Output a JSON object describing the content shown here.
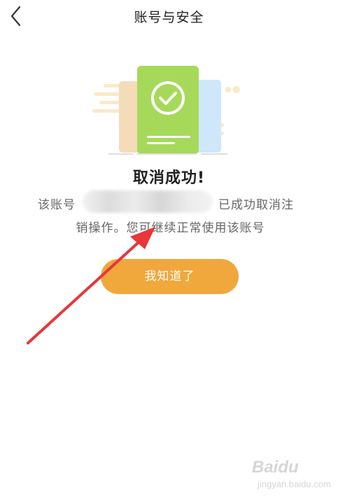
{
  "nav": {
    "title": "账号与安全",
    "back_icon": "chevron-left-icon"
  },
  "result": {
    "title": "取消成功!",
    "desc_prefix": "该账号",
    "desc_suffix": "已成功取消注",
    "desc_line2": "销操作。您可继续正常使用该账号"
  },
  "button": {
    "label": "我知道了"
  },
  "watermark": {
    "brand": "Baidu",
    "sub": "jingyan.baidu.com"
  },
  "colors": {
    "accent_button": "#f0a73c",
    "card_green": "#a6d95a",
    "card_beige": "#f4dcb8",
    "card_blue": "#cfe7fb",
    "annotation_arrow": "#e8363a"
  }
}
